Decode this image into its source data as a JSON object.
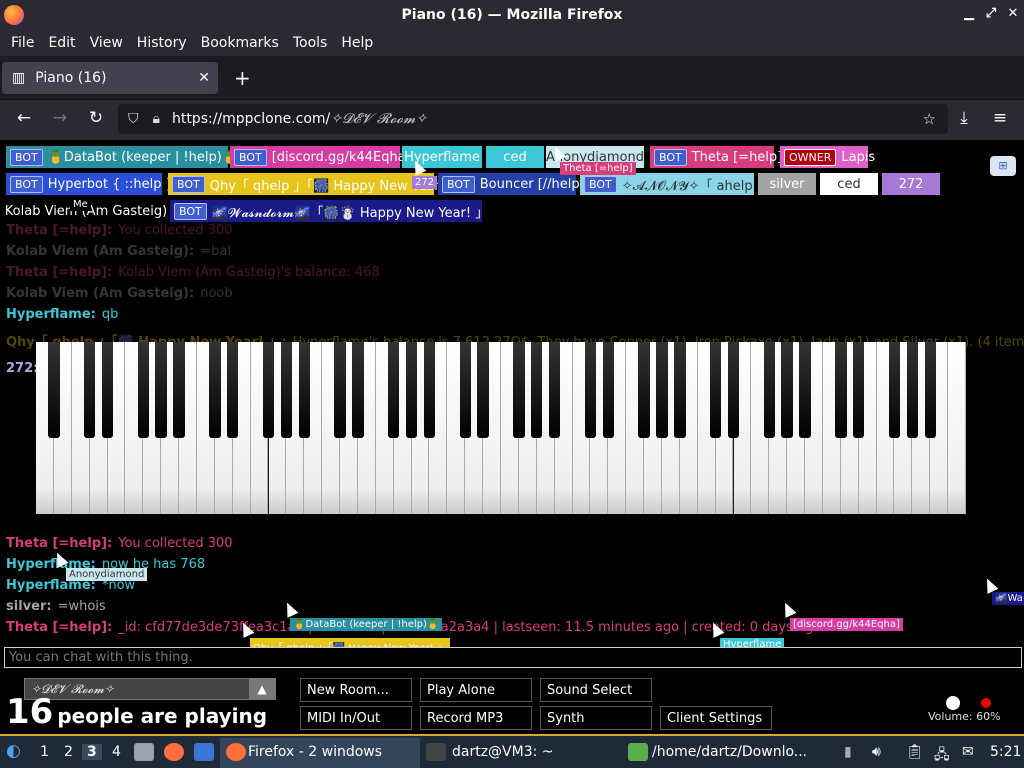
{
  "window": {
    "title": "Piano (16) — Mozilla Firefox"
  },
  "menu": [
    "File",
    "Edit",
    "View",
    "History",
    "Bookmarks",
    "Tools",
    "Help"
  ],
  "tab": {
    "title": "Piano (16)"
  },
  "url": {
    "prefix": "https://mppclone.com/",
    "path": "✧𝓓𝓔𝓥 𝓡𝓸𝓸𝓶✧"
  },
  "badges": [
    {
      "tag": "BOT",
      "name": "🍍DataBot (keeper | !help)🍍",
      "bg": "#2a8f9f"
    },
    {
      "tag": "BOT",
      "name": "[discord.gg/k44Eqha]",
      "bg": "#d63da3"
    },
    {
      "tag": "",
      "name": "Hyperflame",
      "bg": "#3cc7d6"
    },
    {
      "tag": "",
      "name": "ced",
      "bg": "#3cc7d6"
    },
    {
      "tag": "",
      "name": "Anonydiamond",
      "bg": "#c8e8f0"
    },
    {
      "tag": "BOT",
      "name": "Theta [=help]",
      "bg": "#d63d7a"
    },
    {
      "tag": "OWNER",
      "name": "Lapis",
      "bg": "#e060c8"
    },
    {
      "tag": "BOT",
      "name": "Hyperbot { ::help }",
      "bg": "#2b4fd6"
    },
    {
      "tag": "BOT",
      "name": "Qhy「 qhelp 」「🎆 Happy New Year! 」",
      "bg": "#e8c51a"
    },
    {
      "tag": "BOT",
      "name": "Bouncer [//help]",
      "bg": "#2340a8"
    },
    {
      "tag": "BOT",
      "name": "✧𝓐𝓝𝓞𝓝𝓨✧「 ahelp 」",
      "bg": "#8ad4e8"
    },
    {
      "tag": "",
      "name": "silver",
      "bg": "#a2a3a4"
    },
    {
      "tag": "",
      "name": "ced",
      "bg": "#ffffff"
    },
    {
      "tag": "",
      "name": "272",
      "bg": "#a87ad8"
    },
    {
      "tag": "",
      "name": "Kolab Viem (Am Gasteig)",
      "bg": "#000000"
    },
    {
      "tag": "BOT",
      "name": "🌌𝓦𝓪𝓼𝓷𝓭𝓸𝓻𝓶🌌「🎆☃️ Happy New Year! 」",
      "bg": "#1a1a8a"
    }
  ],
  "chat": [
    {
      "name": "Theta [=help]:",
      "msg": "You collected 300",
      "color": "#d63d7a",
      "faded": true
    },
    {
      "name": "Kolab Viem (Am Gasteig):",
      "msg": "=bal",
      "color": "#999999",
      "faded": true
    },
    {
      "name": "Theta [=help]:",
      "msg": "Kolab Viem (Am Gasteig)'s balance: 468",
      "color": "#d63d7a",
      "faded": true
    },
    {
      "name": "Kolab Viem (Am Gasteig):",
      "msg": "noob",
      "color": "#999999",
      "faded": true
    },
    {
      "name": "Hyperflame:",
      "msg": "qb",
      "color": "#3cc7d6",
      "faded": false
    },
    {
      "name": "Qhy「 qhelp 」「🎆 Happy New Year! 」:",
      "msg": "Hyperflame's balance is 7,612 27O$. They have Copper (x1), Iron Pickaxe (x1), Jade (x1) and Silver (x1). (4 items)",
      "color": "#e8c51a",
      "faded": true
    },
    {
      "name": "272:",
      "msg": "=daily",
      "color": "#b8a0e8",
      "faded": false
    },
    {
      "name": "Theta [=help]:",
      "msg": "You collected 300",
      "color": "#d63d7a",
      "faded": false
    },
    {
      "name": "Hyperflame:",
      "msg": "now he has 768",
      "color": "#3cc7d6",
      "faded": false
    },
    {
      "name": "Hyperflame:",
      "msg": "*now",
      "color": "#3cc7d6",
      "faded": false
    },
    {
      "name": "silver:",
      "msg": "=whois",
      "color": "#a2a3a4",
      "faded": false
    },
    {
      "name": "Theta [=help]:",
      "msg": "_id: cfd77de3de73ffea3c1a1 | names: 2 | color: #a2a3a4 | lastseen: 11.5 minutes ago | created: 0 days ago",
      "color": "#d63d7a",
      "faded": false
    }
  ],
  "cursor_tags": [
    {
      "name": "Theta [=help]",
      "bg": "#d63d7a"
    },
    {
      "name": "272",
      "bg": "#a87ad8"
    },
    {
      "name": "Me",
      "bg": "#000000"
    },
    {
      "name": "Anonydiamond",
      "bg": "#c8e8f0"
    },
    {
      "name": "🍍DataBot (keeper | !help)🍍",
      "bg": "#2a8f9f"
    },
    {
      "name": "Qhy「 qhelp 」「🎆 Happy New Year! 」",
      "bg": "#e8c51a"
    },
    {
      "name": "[discord.gg/k44Eqha]",
      "bg": "#d63da3"
    },
    {
      "name": "Hyperflame",
      "bg": "#3cc7d6"
    },
    {
      "name": "🌌Wa",
      "bg": "#1a1a8a"
    }
  ],
  "chat_input": {
    "placeholder": "You can chat with this thing."
  },
  "room": {
    "name": "✧𝓓𝓔𝓥 𝓡𝓸𝓸𝓶✧",
    "count": "16",
    "label": "people are playing"
  },
  "controls": [
    "New Room...",
    "Play Alone",
    "Sound Select",
    "MIDI In/Out",
    "Record MP3",
    "Synth",
    "Client Settings"
  ],
  "volume": {
    "label": "Volume: 60%",
    "level": 0.6
  },
  "taskbar": {
    "workspaces": [
      "1",
      "2",
      "3",
      "4"
    ],
    "firefox": "Firefox - 2 windows",
    "terminal": "dartz@VM3: ~",
    "files": "/home/dartz/Downlo...",
    "clock": "5:21"
  }
}
